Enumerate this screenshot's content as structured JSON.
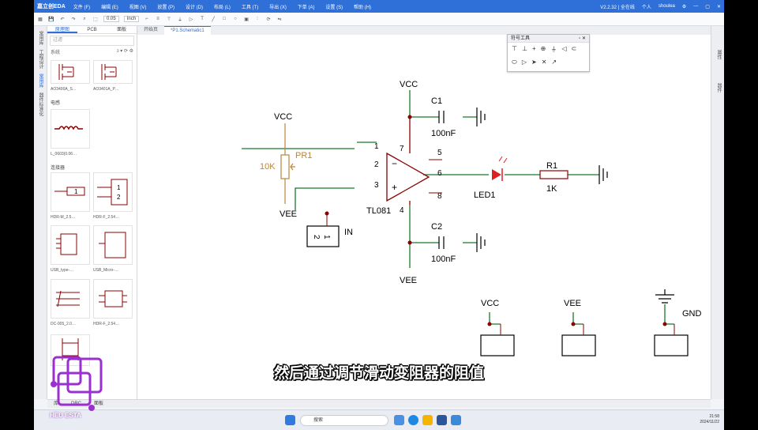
{
  "app": {
    "logo": "嘉立创EDA",
    "menus": [
      "文件 (F)",
      "编辑 (E)",
      "视图 (V)",
      "放置 (P)",
      "设计 (D)",
      "布局 (L)",
      "工具 (T)",
      "导出 (X)",
      "下单 (A)",
      "设置 (S)",
      "帮助 (H)"
    ],
    "version": "V2.2.32 | 全在线",
    "personal": "个人",
    "user": "shoulea"
  },
  "toolbar": {
    "grid": "0.05",
    "unit": "Inch"
  },
  "left_strip": [
    "常用库",
    "工程设计",
    "常用库",
    "器件标准化"
  ],
  "panel": {
    "tabs": [
      "原理图",
      "PCB",
      "面板"
    ],
    "search_placeholder": "过滤",
    "filter_label": "系统",
    "section_inductor": "电感",
    "section_connector": "连接器",
    "captions": [
      "AO3400A_S…",
      "AO3401A_P…",
      "L_0603(0.06…",
      "HDR-M_2.5…",
      "HDR-F_2.54…",
      "USB_type-…",
      "USB_Micro-…",
      "DC-005_2.0…",
      "HDR-F_2.54…"
    ]
  },
  "doc_tabs": [
    "开始页",
    "*P1.Schematic1"
  ],
  "right_strip": [
    "属性",
    "器件"
  ],
  "float_toolbar": {
    "title": "符号工具"
  },
  "bottom_tabs": [
    "库",
    "DRC",
    "面板"
  ],
  "schematic": {
    "vcc_left": "VCC",
    "vee_left": "VEE",
    "pot_ref": "PR1",
    "pot_val": "10K",
    "opamp": "TL081",
    "pin1": "1",
    "pin2": "2",
    "pin3": "3",
    "pin4": "4",
    "pin5": "5",
    "pin6": "6",
    "pin7": "7",
    "pin8": "8",
    "vcc_top": "VCC",
    "vee_bottom": "VEE",
    "c1_ref": "C1",
    "c1_val": "100nF",
    "c2_ref": "C2",
    "c2_val": "100nF",
    "led_ref": "LED1",
    "r1_ref": "R1",
    "r1_val": "1K",
    "in_label": "IN",
    "conn_vcc": "VCC",
    "conn_vee": "VEE",
    "conn_gnd": "GND",
    "hdr_pin_a": "2",
    "hdr_pin_b": "1"
  },
  "taskbar": {
    "search": "搜索",
    "time": "21:58",
    "date": "2024/11/22"
  },
  "overlay": {
    "subtitle": "然后通过调节滑动变阻器的阻值",
    "brand": "HEU ESTA"
  },
  "colors": {
    "accent": "#2e6fd8",
    "wire": "#1a7a2a",
    "symbol": "#8b0000",
    "pot": "#b8863b",
    "led": "#e02020"
  }
}
